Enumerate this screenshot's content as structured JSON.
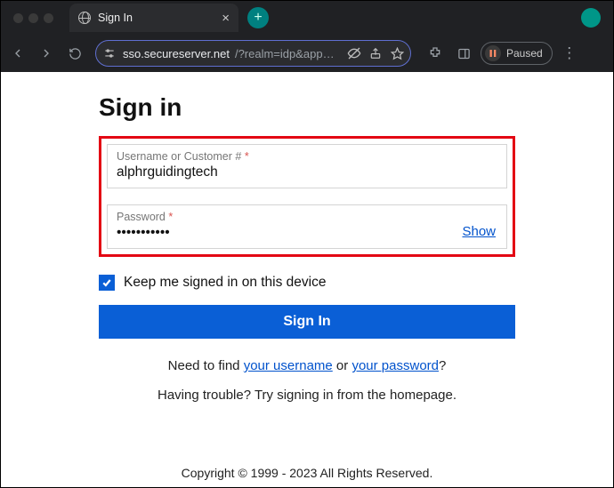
{
  "browser": {
    "tab_title": "Sign In",
    "url_host": "sso.secureserver.net",
    "url_rest": "/?realm=idp&app…",
    "paused_label": "Paused"
  },
  "page": {
    "heading": "Sign in",
    "username": {
      "label": "Username or Customer #",
      "required_mark": "*",
      "value": "alphrguidingtech"
    },
    "password": {
      "label": "Password",
      "required_mark": "*",
      "value": "•••••••••••",
      "show_label": "Show"
    },
    "keep_signed_in_label": "Keep me signed in on this device",
    "sign_in_button": "Sign In",
    "find": {
      "prefix": "Need to find ",
      "username_link": "your username",
      "middle": " or ",
      "password_link": "your password",
      "suffix": "?"
    },
    "trouble": "Having trouble? Try signing in from the homepage.",
    "copyright": "Copyright © 1999 - 2023 All Rights Reserved."
  }
}
